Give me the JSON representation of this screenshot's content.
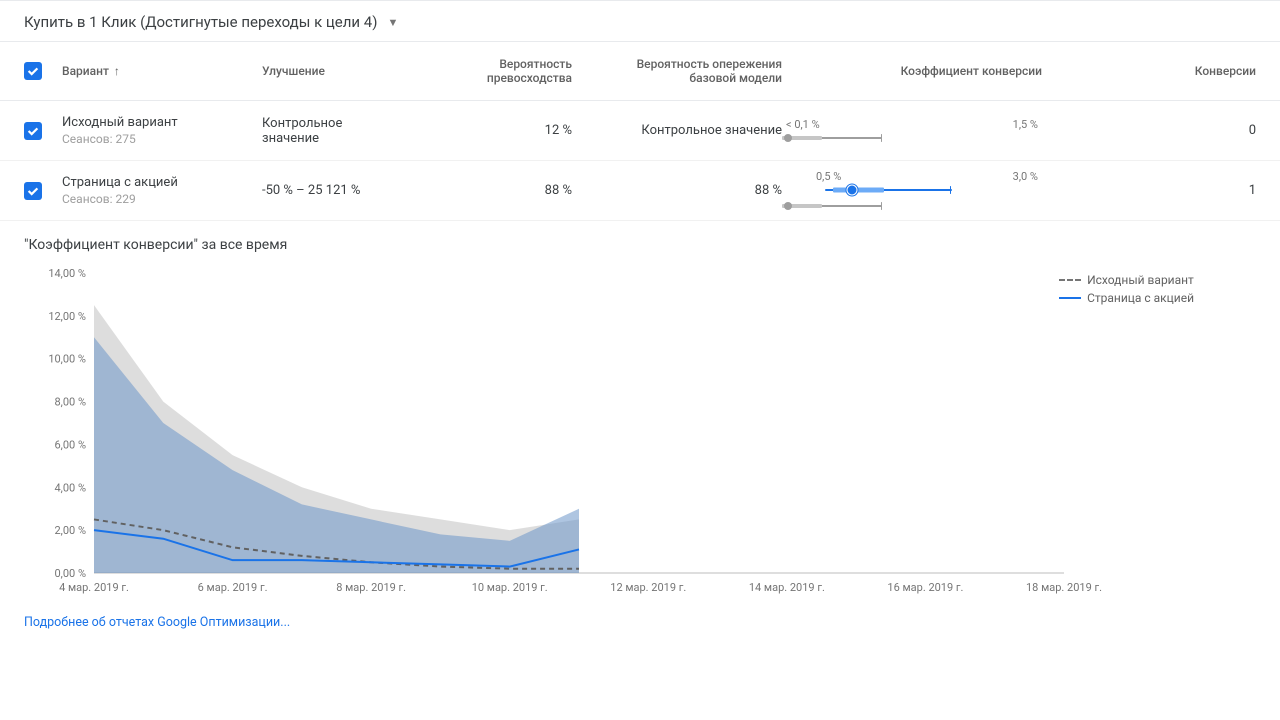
{
  "goal": {
    "label": "Купить в 1 Клик (Достигнутые переходы к цели 4)"
  },
  "columns": {
    "variant": "Вариант",
    "improvement": "Улучшение",
    "prob_sup_l1": "Вероятность",
    "prob_sup_l2": "превосходства",
    "prob_base_l1": "Вероятность опережения",
    "prob_base_l2": "базовой модели",
    "conv_rate": "Коэффициент конверсии",
    "conversions": "Конверсии"
  },
  "rows": [
    {
      "name": "Исходный вариант",
      "sessions": "Сеансов: 275",
      "improvement": "Контрольное значение",
      "prob_sup": "12 %",
      "prob_base": "Контрольное значение",
      "cr_low": "< 0,1 %",
      "cr_high": "1,5 %",
      "conversions": "0"
    },
    {
      "name": "Страница с акцией",
      "sessions": "Сеансов: 229",
      "improvement": "-50 % – 25 121 %",
      "prob_sup": "88 %",
      "prob_base": "88 %",
      "cr_low": "0,5 %",
      "cr_high": "3,0 %",
      "conversions": "1"
    }
  ],
  "chart": {
    "title": "\"Коэффициент конверсии\" за все время",
    "legend": {
      "original": "Исходный вариант",
      "page": "Страница с акцией"
    }
  },
  "footer": {
    "link": "Подробнее об отчетах Google Оптимизации..."
  },
  "chart_data": {
    "type": "line",
    "x": [
      "4 мар. 2019 г.",
      "6 мар. 2019 г.",
      "8 мар. 2019 г.",
      "10 мар. 2019 г.",
      "12 мар. 2019 г.",
      "14 мар. 2019 г.",
      "16 мар. 2019 г.",
      "18 мар. 2019 г."
    ],
    "x_positions": [
      0,
      1,
      2,
      3,
      4,
      5,
      6,
      7
    ],
    "ylabel": "",
    "ylim": [
      0,
      14
    ],
    "y_ticks": [
      "0,00 %",
      "2,00 %",
      "4,00 %",
      "6,00 %",
      "8,00 %",
      "10,00 %",
      "12,00 %",
      "14,00 %"
    ],
    "series": [
      {
        "name": "Исходный вариант",
        "style": "dashed-grey",
        "x": [
          0,
          0.5,
          1,
          1.5,
          2,
          2.5,
          3,
          3.5
        ],
        "values": [
          2.5,
          2.0,
          1.2,
          0.8,
          0.5,
          0.3,
          0.2,
          0.2
        ],
        "band_low": [
          0,
          0,
          0,
          0,
          0,
          0,
          0,
          0
        ],
        "band_high": [
          12.5,
          8.0,
          5.5,
          4.0,
          3.0,
          2.5,
          2.0,
          2.5
        ]
      },
      {
        "name": "Страница с акцией",
        "style": "solid-blue",
        "x": [
          0,
          0.5,
          1,
          1.5,
          2,
          2.5,
          3,
          3.5
        ],
        "values": [
          2.0,
          1.6,
          0.6,
          0.6,
          0.5,
          0.4,
          0.3,
          1.1
        ],
        "band_low": [
          0,
          0,
          0,
          0,
          0,
          0,
          0,
          0
        ],
        "band_high": [
          11.0,
          7.0,
          4.8,
          3.2,
          2.5,
          1.8,
          1.5,
          3.0
        ]
      }
    ]
  }
}
